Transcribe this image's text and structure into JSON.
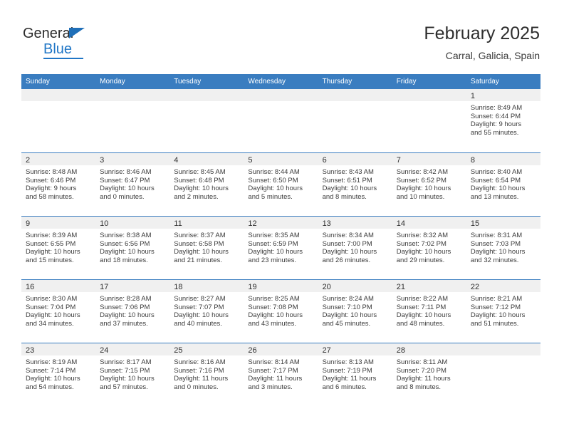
{
  "brand": {
    "logo_text_primary": "General",
    "logo_text_secondary": "Blue",
    "logo_icon": "triangle-icon",
    "accent_color": "#2076c6",
    "header_color": "#3a7dc0"
  },
  "header": {
    "title": "February 2025",
    "location": "Carral, Galicia, Spain"
  },
  "calendar": {
    "day_headers": [
      "Sunday",
      "Monday",
      "Tuesday",
      "Wednesday",
      "Thursday",
      "Friday",
      "Saturday"
    ],
    "weeks": [
      [
        {
          "day": "",
          "lines": []
        },
        {
          "day": "",
          "lines": []
        },
        {
          "day": "",
          "lines": []
        },
        {
          "day": "",
          "lines": []
        },
        {
          "day": "",
          "lines": []
        },
        {
          "day": "",
          "lines": []
        },
        {
          "day": "1",
          "lines": [
            "Sunrise: 8:49 AM",
            "Sunset: 6:44 PM",
            "Daylight: 9 hours",
            "and 55 minutes."
          ]
        }
      ],
      [
        {
          "day": "2",
          "lines": [
            "Sunrise: 8:48 AM",
            "Sunset: 6:46 PM",
            "Daylight: 9 hours",
            "and 58 minutes."
          ]
        },
        {
          "day": "3",
          "lines": [
            "Sunrise: 8:46 AM",
            "Sunset: 6:47 PM",
            "Daylight: 10 hours",
            "and 0 minutes."
          ]
        },
        {
          "day": "4",
          "lines": [
            "Sunrise: 8:45 AM",
            "Sunset: 6:48 PM",
            "Daylight: 10 hours",
            "and 2 minutes."
          ]
        },
        {
          "day": "5",
          "lines": [
            "Sunrise: 8:44 AM",
            "Sunset: 6:50 PM",
            "Daylight: 10 hours",
            "and 5 minutes."
          ]
        },
        {
          "day": "6",
          "lines": [
            "Sunrise: 8:43 AM",
            "Sunset: 6:51 PM",
            "Daylight: 10 hours",
            "and 8 minutes."
          ]
        },
        {
          "day": "7",
          "lines": [
            "Sunrise: 8:42 AM",
            "Sunset: 6:52 PM",
            "Daylight: 10 hours",
            "and 10 minutes."
          ]
        },
        {
          "day": "8",
          "lines": [
            "Sunrise: 8:40 AM",
            "Sunset: 6:54 PM",
            "Daylight: 10 hours",
            "and 13 minutes."
          ]
        }
      ],
      [
        {
          "day": "9",
          "lines": [
            "Sunrise: 8:39 AM",
            "Sunset: 6:55 PM",
            "Daylight: 10 hours",
            "and 15 minutes."
          ]
        },
        {
          "day": "10",
          "lines": [
            "Sunrise: 8:38 AM",
            "Sunset: 6:56 PM",
            "Daylight: 10 hours",
            "and 18 minutes."
          ]
        },
        {
          "day": "11",
          "lines": [
            "Sunrise: 8:37 AM",
            "Sunset: 6:58 PM",
            "Daylight: 10 hours",
            "and 21 minutes."
          ]
        },
        {
          "day": "12",
          "lines": [
            "Sunrise: 8:35 AM",
            "Sunset: 6:59 PM",
            "Daylight: 10 hours",
            "and 23 minutes."
          ]
        },
        {
          "day": "13",
          "lines": [
            "Sunrise: 8:34 AM",
            "Sunset: 7:00 PM",
            "Daylight: 10 hours",
            "and 26 minutes."
          ]
        },
        {
          "day": "14",
          "lines": [
            "Sunrise: 8:32 AM",
            "Sunset: 7:02 PM",
            "Daylight: 10 hours",
            "and 29 minutes."
          ]
        },
        {
          "day": "15",
          "lines": [
            "Sunrise: 8:31 AM",
            "Sunset: 7:03 PM",
            "Daylight: 10 hours",
            "and 32 minutes."
          ]
        }
      ],
      [
        {
          "day": "16",
          "lines": [
            "Sunrise: 8:30 AM",
            "Sunset: 7:04 PM",
            "Daylight: 10 hours",
            "and 34 minutes."
          ]
        },
        {
          "day": "17",
          "lines": [
            "Sunrise: 8:28 AM",
            "Sunset: 7:06 PM",
            "Daylight: 10 hours",
            "and 37 minutes."
          ]
        },
        {
          "day": "18",
          "lines": [
            "Sunrise: 8:27 AM",
            "Sunset: 7:07 PM",
            "Daylight: 10 hours",
            "and 40 minutes."
          ]
        },
        {
          "day": "19",
          "lines": [
            "Sunrise: 8:25 AM",
            "Sunset: 7:08 PM",
            "Daylight: 10 hours",
            "and 43 minutes."
          ]
        },
        {
          "day": "20",
          "lines": [
            "Sunrise: 8:24 AM",
            "Sunset: 7:10 PM",
            "Daylight: 10 hours",
            "and 45 minutes."
          ]
        },
        {
          "day": "21",
          "lines": [
            "Sunrise: 8:22 AM",
            "Sunset: 7:11 PM",
            "Daylight: 10 hours",
            "and 48 minutes."
          ]
        },
        {
          "day": "22",
          "lines": [
            "Sunrise: 8:21 AM",
            "Sunset: 7:12 PM",
            "Daylight: 10 hours",
            "and 51 minutes."
          ]
        }
      ],
      [
        {
          "day": "23",
          "lines": [
            "Sunrise: 8:19 AM",
            "Sunset: 7:14 PM",
            "Daylight: 10 hours",
            "and 54 minutes."
          ]
        },
        {
          "day": "24",
          "lines": [
            "Sunrise: 8:17 AM",
            "Sunset: 7:15 PM",
            "Daylight: 10 hours",
            "and 57 minutes."
          ]
        },
        {
          "day": "25",
          "lines": [
            "Sunrise: 8:16 AM",
            "Sunset: 7:16 PM",
            "Daylight: 11 hours",
            "and 0 minutes."
          ]
        },
        {
          "day": "26",
          "lines": [
            "Sunrise: 8:14 AM",
            "Sunset: 7:17 PM",
            "Daylight: 11 hours",
            "and 3 minutes."
          ]
        },
        {
          "day": "27",
          "lines": [
            "Sunrise: 8:13 AM",
            "Sunset: 7:19 PM",
            "Daylight: 11 hours",
            "and 6 minutes."
          ]
        },
        {
          "day": "28",
          "lines": [
            "Sunrise: 8:11 AM",
            "Sunset: 7:20 PM",
            "Daylight: 11 hours",
            "and 8 minutes."
          ]
        },
        {
          "day": "",
          "lines": []
        }
      ]
    ]
  }
}
